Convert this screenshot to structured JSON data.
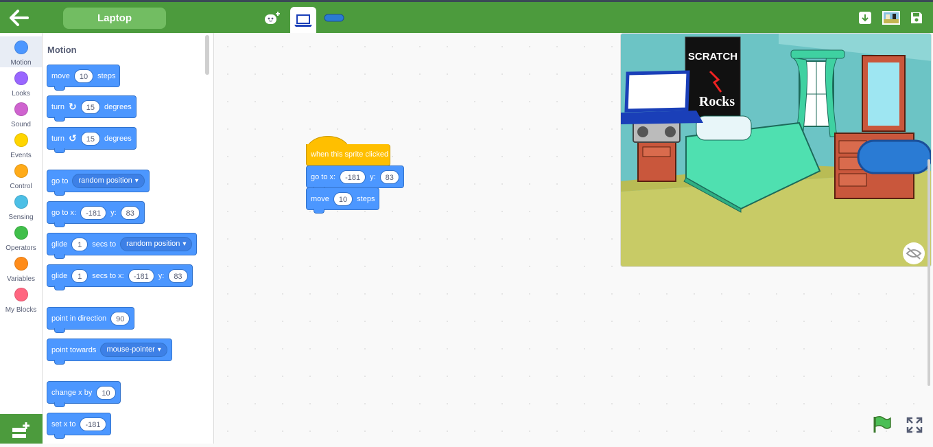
{
  "header": {
    "sprite_name": "Laptop",
    "icons": [
      "back-arrow-icon",
      "costume-tab-icon",
      "laptop-tab-icon",
      "button-sprite-tab-icon",
      "download-icon",
      "backdrop-icon",
      "save-icon"
    ]
  },
  "categories": [
    {
      "label": "Motion",
      "color": "#4c97ff"
    },
    {
      "label": "Looks",
      "color": "#9966ff"
    },
    {
      "label": "Sound",
      "color": "#cf63cf"
    },
    {
      "label": "Events",
      "color": "#ffd500"
    },
    {
      "label": "Control",
      "color": "#ffab19"
    },
    {
      "label": "Sensing",
      "color": "#4cbfe6"
    },
    {
      "label": "Operators",
      "color": "#40bf4a"
    },
    {
      "label": "Variables",
      "color": "#ff8c1a"
    },
    {
      "label": "My Blocks",
      "color": "#ff6680"
    }
  ],
  "palette": {
    "title": "Motion",
    "move": {
      "a": "move",
      "n": "10",
      "b": "steps"
    },
    "turn_cw": {
      "a": "turn",
      "n": "15",
      "b": "degrees"
    },
    "turn_ccw": {
      "a": "turn",
      "n": "15",
      "b": "degrees"
    },
    "goto": {
      "a": "go to",
      "dd": "random position"
    },
    "gotoxy": {
      "a": "go to x:",
      "x": "-181",
      "b": "y:",
      "y": "83"
    },
    "glide1": {
      "a": "glide",
      "n": "1",
      "b": "secs to",
      "dd": "random position"
    },
    "glide2": {
      "a": "glide",
      "n": "1",
      "b": "secs to x:",
      "x": "-181",
      "c": "y:",
      "y": "83"
    },
    "direction": {
      "a": "point in direction",
      "n": "90"
    },
    "towards": {
      "a": "point towards",
      "dd": "mouse-pointer"
    },
    "changex": {
      "a": "change x by",
      "n": "10"
    },
    "setx": {
      "a": "set x to",
      "n": "-181"
    }
  },
  "script": {
    "hat": "when this sprite clicked",
    "gotoxy": {
      "a": "go to x:",
      "x": "-181",
      "b": "y:",
      "y": "83"
    },
    "move": {
      "a": "move",
      "n": "10",
      "b": "steps"
    }
  },
  "stage": {
    "poster_line1": "SCRATCH",
    "poster_line2": "Rocks"
  }
}
